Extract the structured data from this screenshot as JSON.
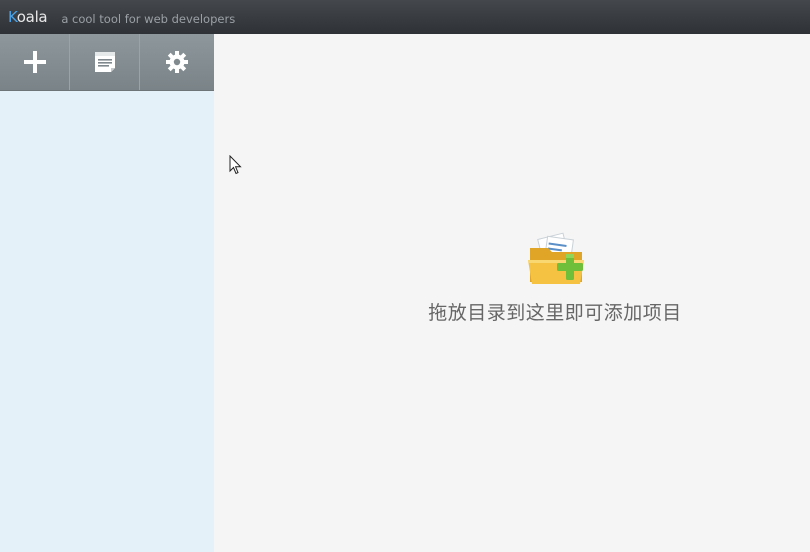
{
  "titlebar": {
    "app_name_first_letter": "K",
    "app_name_rest": "oala",
    "tagline": "a cool tool for web developers"
  },
  "toolbar": {
    "buttons": [
      {
        "icon": "plus-icon"
      },
      {
        "icon": "document-icon"
      },
      {
        "icon": "gear-icon"
      }
    ]
  },
  "empty_state": {
    "icon": "folder-add-icon",
    "message": "拖放目录到这里即可添加项目"
  },
  "colors": {
    "titlebar": "#35393d",
    "sidebar_bg": "#e4f1f9",
    "toolbar_bg": "#858e92",
    "main_bg": "#f5f5f5",
    "brand_accent": "#4aa3e8"
  }
}
